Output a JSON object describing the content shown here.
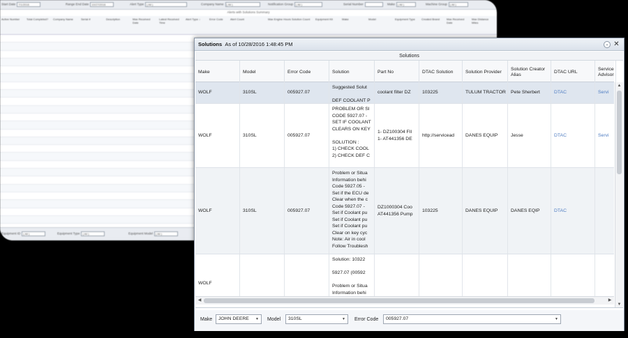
{
  "background_window": {
    "filters": [
      {
        "label": "Start Date",
        "value": "7/1/2016"
      },
      {
        "label": "Range End Date",
        "value": "10/27/2016"
      },
      {
        "label": "Alert Type",
        "value": "( All )"
      },
      {
        "label": "Company Name",
        "value": "( All )"
      },
      {
        "label": "Notification Group",
        "value": "( All )"
      },
      {
        "label": "Serial Number",
        "value": ""
      },
      {
        "label": "Make",
        "value": "( All )"
      },
      {
        "label": "Machine Group",
        "value": "( All )"
      }
    ],
    "title": "Alerts with Solutions Summary",
    "columns": [
      "Active Number",
      "Total Completed?",
      "Company Name",
      "Serial #",
      "Description",
      "Max Received Date",
      "Latest Received Time",
      "Alert Type ↓",
      "Error Code",
      "Alert Count",
      "Max Engine Hours",
      "Solution Count",
      "Equipment Kit",
      "Make",
      "Model",
      "Equipment Type",
      "Created Brand",
      "Max Received Date",
      "Max Distance Miles"
    ],
    "footer_filters": [
      {
        "label": "Equipment ID",
        "value": "( All )"
      },
      {
        "label": "Equipment Type",
        "value": "( All )"
      },
      {
        "label": "Equipment Model",
        "value": "( All )"
      }
    ]
  },
  "dialog": {
    "title": "Solutions",
    "subtitle": "As of 10/28/2016 1:48:45 PM",
    "grid_caption": "Solutions",
    "columns": [
      "Make",
      "Model",
      "Error Code",
      "Solution",
      "Part No",
      "DTAC Solution",
      "Solution Provider",
      "Solution Creator Alias",
      "DTAC URL",
      "Service Advisor"
    ],
    "rows": [
      {
        "make": "WOLF",
        "model": "310SL",
        "error_code": "005927.07",
        "solution": "Suggested Solut\n\nDEF COOLANT P",
        "part_no": "coolant filter DZ",
        "dtac_solution": "103225",
        "provider": "TULUM TRACTOR",
        "creator": "Pete Sherbert",
        "dtac_url": "DTAC",
        "service_advisor": "Servi"
      },
      {
        "make": "WOLF",
        "model": "310SL",
        "error_code": "005927.07",
        "solution": "PROBLEM OR SI\nCODE 5927.07 -\nSET IF COOLANT\nCLEARS ON KEY\n\nSOLUTION :\n1) CHECK COOL\n2) CHECK DEF C",
        "part_no": "1- DZ100304 FII\n1- AT441356 DE",
        "dtac_solution": "http://servicead",
        "provider": "DANES EQUIP",
        "creator": "Jesse",
        "dtac_url": "DTAC",
        "service_advisor": "Servi"
      },
      {
        "make": "WOLF",
        "model": "310SL",
        "error_code": "005927.07",
        "solution": "Problem or Situa\nInformation behi\nCode 5927.05 -\nSet if the ECU de\nClear when the c\nCode 5927.07 -\nSet if Coolant pu\nSet if Coolant pu\nSet if Coolant pu\nClear on key cyc\nNote: Air in cool\nFollow Troublesh",
        "part_no": "DZ1000304 Coo\nAT441356 Pump",
        "dtac_solution": "103225",
        "provider": "DANES EQUIP",
        "creator": "DANES EQIP",
        "dtac_url": "DTAC",
        "service_advisor": ""
      },
      {
        "make": "WOLF",
        "model": "",
        "error_code": "",
        "solution": "Solution: 10322\n\n5927.07 (00592\n\nProblem or Situa\nInformation behi",
        "part_no": "",
        "dtac_solution": "",
        "provider": "",
        "creator": "",
        "dtac_url": "",
        "service_advisor": ""
      }
    ],
    "footer": {
      "make_label": "Make",
      "make_value": "JOHN DEERE",
      "model_label": "Model",
      "model_value": "310SL",
      "error_label": "Error Code",
      "error_value": "005927.07"
    }
  }
}
